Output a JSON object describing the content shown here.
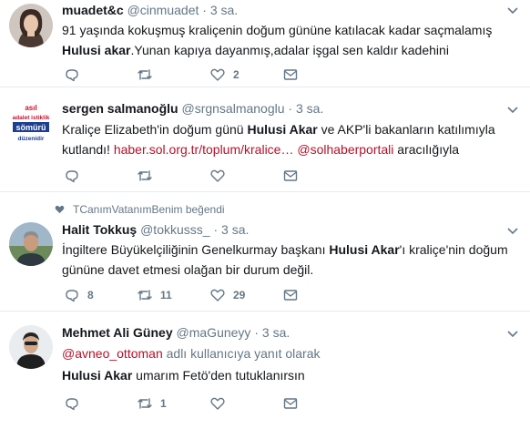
{
  "tweets": [
    {
      "fullname": "muadet&c",
      "handle": "@cinmuadet",
      "dot": "·",
      "time": "3 sa.",
      "line1": "91 yaşında kokuşmuş kraliçenin doğum gününe katılacak kadar saçmalamış",
      "line2_bold": "Hulusi akar",
      "line2_rest": ".Yunan kapıya dayanmış,adalar işgal sen kaldır kadehini",
      "reply_count": "",
      "retweet_count": "",
      "like_count": "2"
    },
    {
      "fullname": "sergen salmanoğlu",
      "handle": "@srgnsalmanoglu",
      "dot": "·",
      "time": "3 sa.",
      "avatar_lines": [
        "asıl",
        "adalet istiklik",
        "sömürü",
        "düzenidir"
      ],
      "line1_a": "Kraliçe Elizabeth'in doğum günü ",
      "line1_bold": "Hulusi Akar",
      "line1_b": " ve AKP'li bakanların katılımıyla",
      "line2_a": "kutlandı! ",
      "line2_link": "haber.sol.org.tr/toplum/kralice…",
      "line2_sp": " ",
      "line2_mention": "@solhaberportali",
      "line2_b": " aracılığıyla",
      "reply_count": "",
      "retweet_count": "",
      "like_count": ""
    },
    {
      "context": "TCanımVatanımBenim beğendi",
      "fullname": "Halit Tokkuş",
      "handle": "@tokkusss_",
      "dot": "·",
      "time": "3 sa.",
      "line1_a": "İngiltere Büyükelçiliğinin Genelkurmay başkanı ",
      "line1_bold": "Hulusi Akar",
      "line1_b": "'ı kraliçe'nin doğum",
      "line2": "gününe davet etmesi olağan bir durum değil.",
      "reply_count": "8",
      "retweet_count": "11",
      "like_count": "29"
    },
    {
      "fullname": "Mehmet Ali Güney",
      "handle": "@maGuneyy",
      "dot": "·",
      "time": "3 sa.",
      "reply_mention": "@avneo_ottoman",
      "reply_rest": " adlı kullanıcıya yanıt olarak",
      "line_bold": "Hulusi Akar",
      "line_rest": " umarım Fetö'den tutuklanırsın",
      "reply_count": "",
      "retweet_count": "1",
      "like_count": ""
    }
  ],
  "colors": {
    "text": "#14171a",
    "secondary": "#657786",
    "link": "#b5112a",
    "divider": "#e6ecf0"
  },
  "icons": [
    "reply-icon",
    "retweet-icon",
    "heart-icon",
    "message-icon",
    "chevron-down-icon",
    "small-heart-icon"
  ]
}
